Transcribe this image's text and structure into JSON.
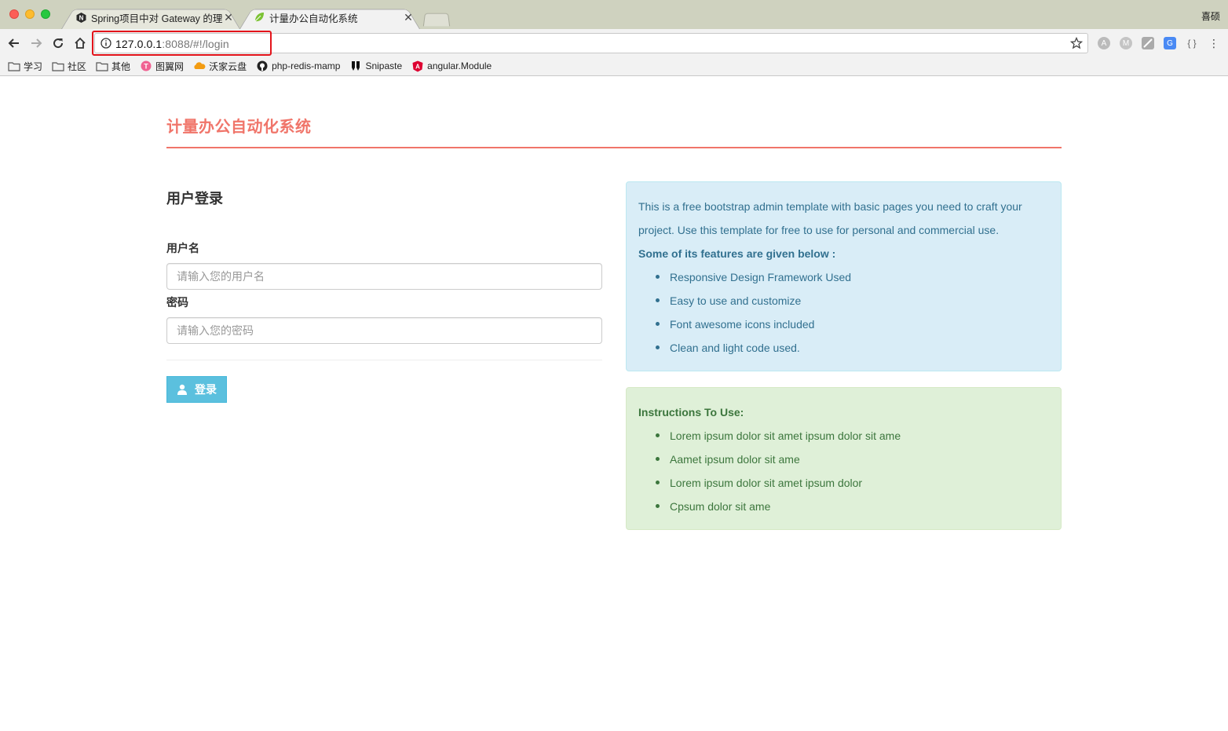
{
  "browser": {
    "tabs": [
      {
        "title": "Spring项目中对 Gateway 的理解",
        "favicon": "n-logo-icon"
      },
      {
        "title": "计量办公自动化系统",
        "favicon": "spring-leaf-icon"
      }
    ],
    "profile_name": "喜硕",
    "url_host": "127.0.0.1",
    "url_path": ":8088/#!/login",
    "bookmarks": [
      {
        "label": "学习",
        "icon": "folder-icon"
      },
      {
        "label": "社区",
        "icon": "folder-icon"
      },
      {
        "label": "其他",
        "icon": "folder-icon"
      },
      {
        "label": "图翼网",
        "icon": "tuyi-icon"
      },
      {
        "label": "沃家云盘",
        "icon": "cloud-icon"
      },
      {
        "label": "php-redis-mamp",
        "icon": "github-icon"
      },
      {
        "label": "Snipaste",
        "icon": "snipaste-icon"
      },
      {
        "label": "angular.Module",
        "icon": "angular-icon"
      }
    ]
  },
  "app": {
    "title": "计量办公自动化系统",
    "accent_color": "#f0756a"
  },
  "login": {
    "heading": "用户登录",
    "username_label": "用户名",
    "username_placeholder": "请输入您的用户名",
    "password_label": "密码",
    "password_placeholder": "请输入您的密码",
    "submit_label": "登录"
  },
  "info_panel": {
    "intro": "This is a free bootstrap admin template with basic pages you need to craft your project. Use this template for free to use for personal and commercial use.",
    "features_heading": "Some of its features are given below :",
    "features": [
      "Responsive Design Framework Used",
      "Easy to use and customize",
      "Font awesome icons included",
      "Clean and light code used."
    ]
  },
  "instructions_panel": {
    "heading": "Instructions To Use:",
    "items": [
      "Lorem ipsum dolor sit amet ipsum dolor sit ame",
      "Aamet ipsum dolor sit ame",
      "Lorem ipsum dolor sit amet ipsum dolor",
      "Cpsum dolor sit ame"
    ]
  }
}
